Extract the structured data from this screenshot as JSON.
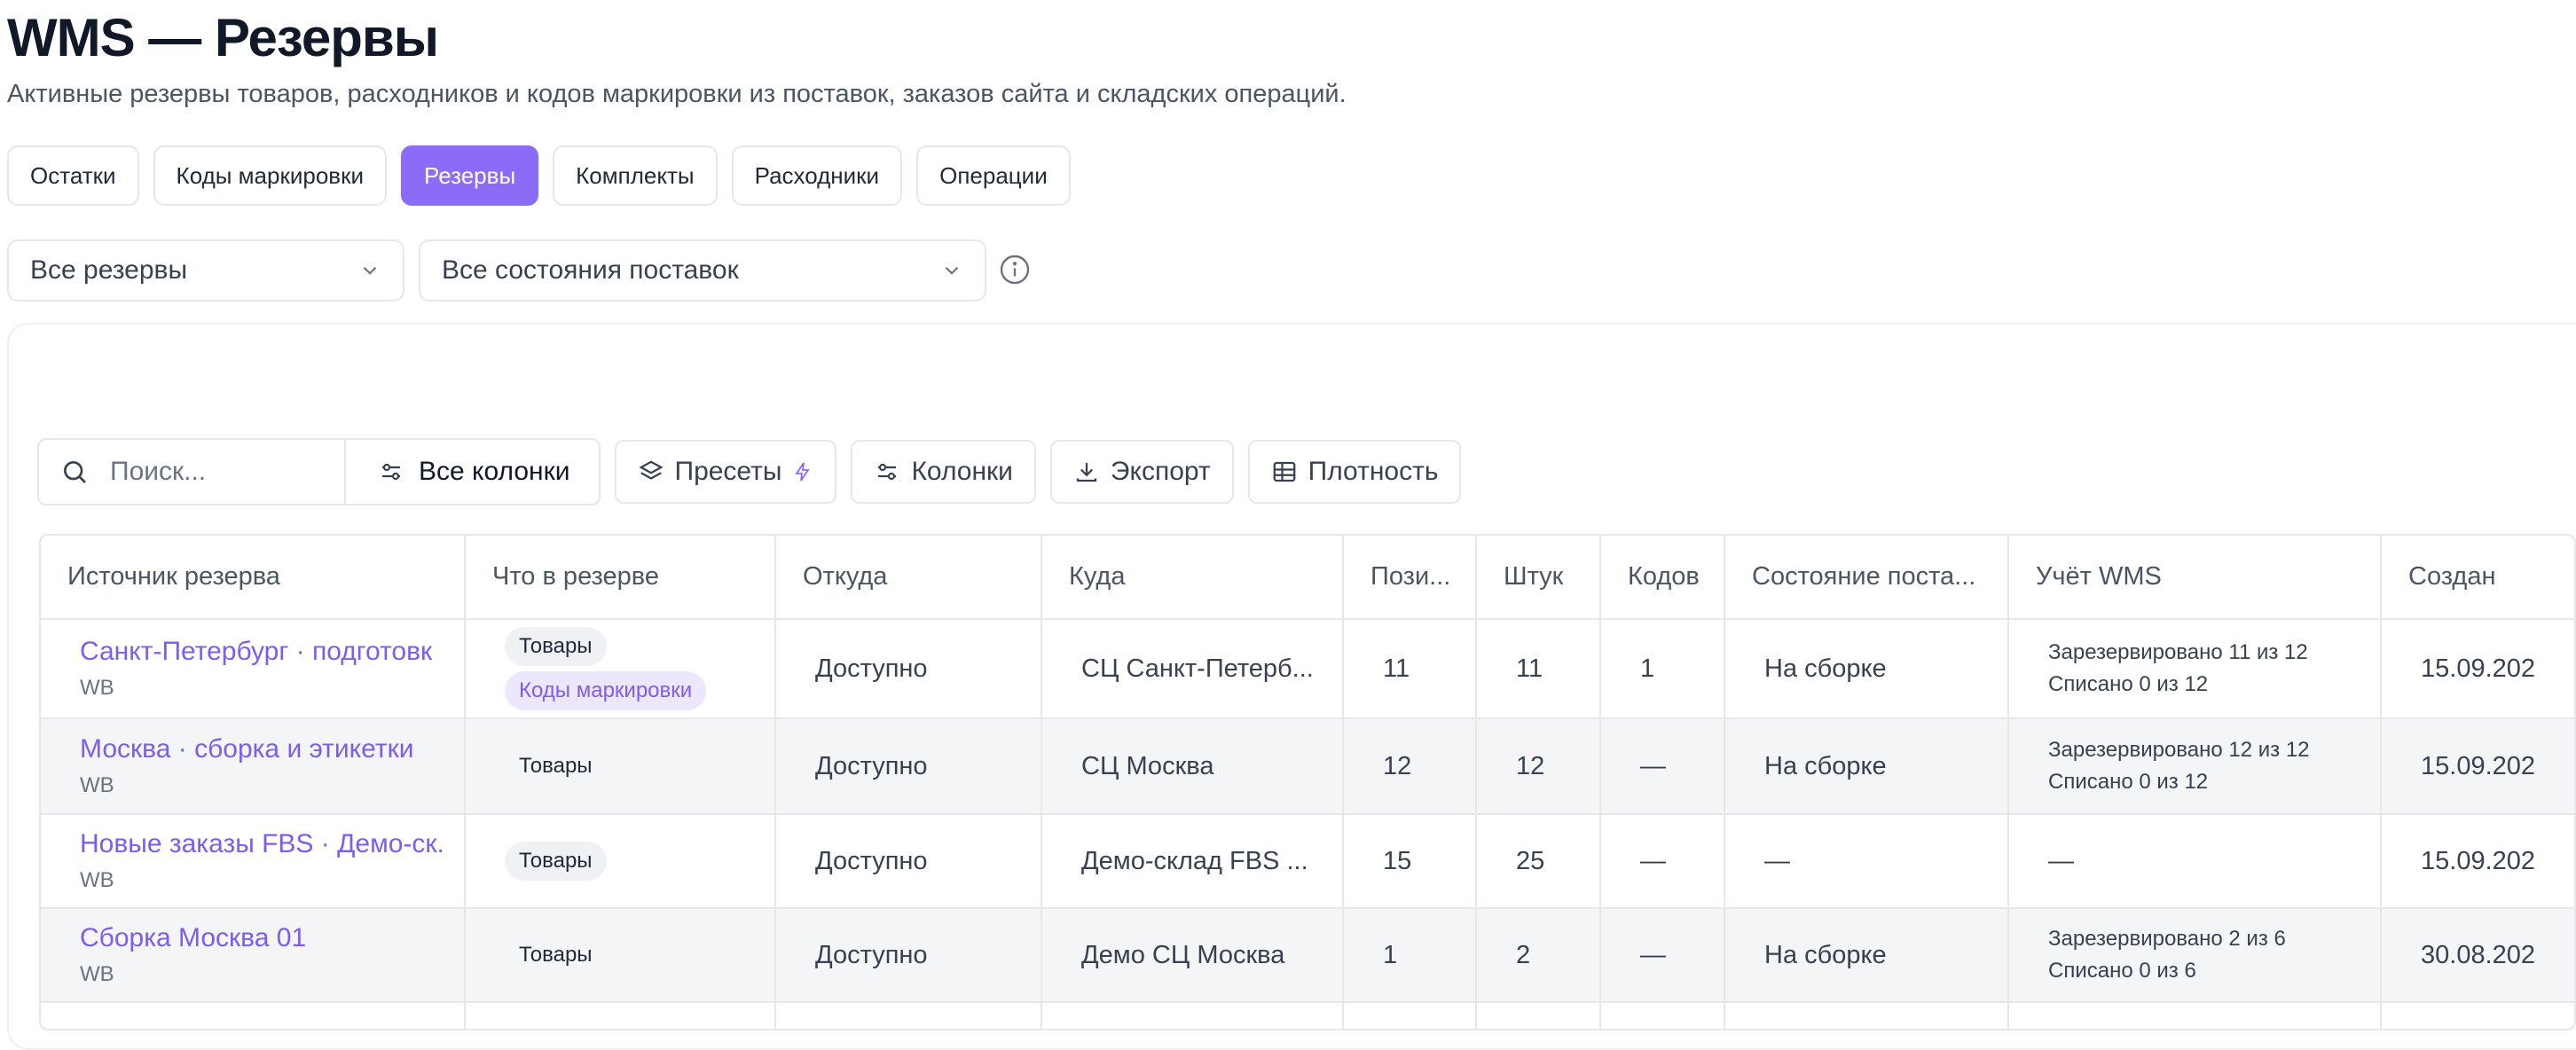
{
  "page": {
    "title": "WMS — Резервы",
    "subtitle": "Активные резервы товаров, расходников и кодов маркировки из поставок, заказов сайта и складских операций."
  },
  "tabs": [
    {
      "label": "Остатки",
      "active": false
    },
    {
      "label": "Коды маркировки",
      "active": false
    },
    {
      "label": "Резервы",
      "active": true
    },
    {
      "label": "Комплекты",
      "active": false
    },
    {
      "label": "Расходники",
      "active": false
    },
    {
      "label": "Операции",
      "active": false
    }
  ],
  "filters": {
    "reserve_filter": "Все резервы",
    "supply_state_filter": "Все состояния поставок"
  },
  "toolbar": {
    "search_placeholder": "Поиск...",
    "all_columns": "Все колонки",
    "presets": "Пресеты",
    "columns": "Колонки",
    "export": "Экспорт",
    "density": "Плотность"
  },
  "table": {
    "headers": [
      "Источник резерва",
      "Что в резерве",
      "Откуда",
      "Куда",
      "Пози...",
      "Штук",
      "Кодов",
      "Состояние поста...",
      "Учёт WMS",
      "Создан"
    ],
    "rows": [
      {
        "source": "Санкт-Петербург · подготовк",
        "marketplace": "WB",
        "tags": [
          {
            "label": "Товары",
            "style": "gray"
          },
          {
            "label": "Коды маркировки",
            "style": "purple"
          }
        ],
        "from": "Доступно",
        "to": "СЦ Санкт-Петерб...",
        "positions": "11",
        "pieces": "11",
        "codes": "1",
        "state": "На сборке",
        "wms_reserved": "Зарезервировано 11 из 12",
        "wms_written_off": "Списано 0 из 12",
        "wms_dash": "",
        "created": "15.09.202"
      },
      {
        "source": "Москва · сборка и этикетки",
        "marketplace": "WB",
        "tags": [
          {
            "label": "Товары",
            "style": "plain"
          }
        ],
        "from": "Доступно",
        "to": "СЦ Москва",
        "positions": "12",
        "pieces": "12",
        "codes": "—",
        "state": "На сборке",
        "wms_reserved": "Зарезервировано 12 из 12",
        "wms_written_off": "Списано 0 из 12",
        "wms_dash": "",
        "created": "15.09.202"
      },
      {
        "source": "Новые заказы FBS · Демо-ск.",
        "marketplace": "WB",
        "tags": [
          {
            "label": "Товары",
            "style": "gray"
          }
        ],
        "from": "Доступно",
        "to": "Демо-склад FBS ...",
        "positions": "15",
        "pieces": "25",
        "codes": "—",
        "state": "—",
        "wms_reserved": "",
        "wms_written_off": "",
        "wms_dash": "—",
        "created": "15.09.202"
      },
      {
        "source": "Сборка Москва 01",
        "marketplace": "WB",
        "tags": [
          {
            "label": "Товары",
            "style": "plain"
          }
        ],
        "from": "Доступно",
        "to": "Демо СЦ Москва",
        "positions": "1",
        "pieces": "2",
        "codes": "—",
        "state": "На сборке",
        "wms_reserved": "Зарезервировано 2 из 6",
        "wms_written_off": "Списано 0 из 6",
        "wms_dash": "",
        "created": "30.08.202"
      }
    ]
  },
  "colors": {
    "accent": "#8b6cf7",
    "link": "#7c5cf3",
    "border": "#e5e7eb",
    "row_alt": "#f4f5f7"
  }
}
